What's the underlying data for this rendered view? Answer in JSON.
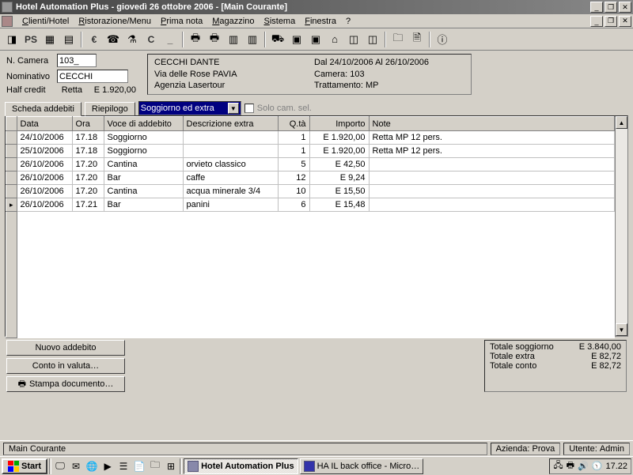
{
  "titlebar": {
    "title": "Hotel Automation Plus - giovedì 26 ottobre 2006 - [Main Courante]"
  },
  "menu": {
    "clienti": "Clienti/Hotel",
    "ristorazione": "Ristorazione/Menu",
    "prima_nota": "Prima nota",
    "magazzino": "Magazzino",
    "sistema": "Sistema",
    "finestra": "Finestra",
    "help": "?"
  },
  "form": {
    "n_camera_label": "N. Camera",
    "n_camera_value": "103_",
    "nominativo_label": "Nominativo",
    "nominativo_value": "CECCHI",
    "half_credit_label": "Half credit",
    "retta_label": "Retta",
    "retta_value": "E 1.920,00"
  },
  "panel": {
    "name": "CECCHI DANTE",
    "period": "Dal 24/10/2006 Al 26/10/2006",
    "address": "Via delle Rose PAVIA",
    "camera": "Camera: 103",
    "agenzia": "Agenzia Lasertour",
    "trattamento": "Trattamento: MP"
  },
  "tabs": {
    "scheda": "Scheda addebiti",
    "riepilogo": "Riepilogo",
    "combo_value": "Soggiorno ed extra",
    "solo_cam": "Solo cam. sel."
  },
  "grid": {
    "headers": {
      "data": "Data",
      "ora": "Ora",
      "voce": "Voce di addebito",
      "descr": "Descrizione extra",
      "qta": "Q.tà",
      "importo": "Importo",
      "note": "Note"
    },
    "rows": [
      {
        "data": "24/10/2006",
        "ora": "17.18",
        "voce": "Soggiorno",
        "descr": "",
        "qta": "1",
        "importo": "E 1.920,00",
        "note": "Retta MP 12 pers."
      },
      {
        "data": "25/10/2006",
        "ora": "17.18",
        "voce": "Soggiorno",
        "descr": "",
        "qta": "1",
        "importo": "E 1.920,00",
        "note": "Retta MP 12 pers."
      },
      {
        "data": "26/10/2006",
        "ora": "17.20",
        "voce": "Cantina",
        "descr": "orvieto classico",
        "qta": "5",
        "importo": "E 42,50",
        "note": ""
      },
      {
        "data": "26/10/2006",
        "ora": "17.20",
        "voce": "Bar",
        "descr": "caffe",
        "qta": "12",
        "importo": "E 9,24",
        "note": ""
      },
      {
        "data": "26/10/2006",
        "ora": "17.20",
        "voce": "Cantina",
        "descr": "acqua minerale 3/4",
        "qta": "10",
        "importo": "E 15,50",
        "note": ""
      },
      {
        "data": "26/10/2006",
        "ora": "17.21",
        "voce": "Bar",
        "descr": "panini",
        "qta": "6",
        "importo": "E 15,48",
        "note": ""
      }
    ]
  },
  "buttons": {
    "nuovo": "Nuovo addebito",
    "conto": "Conto in valuta…",
    "stampa": "Stampa documento…"
  },
  "totals": {
    "soggiorno_label": "Totale soggiorno",
    "soggiorno_value": "E 3.840,00",
    "extra_label": "Totale extra",
    "extra_value": "E 82,72",
    "conto_label": "Totale conto",
    "conto_value": "E 82,72"
  },
  "status": {
    "main": "Main Courante",
    "azienda_label": "Azienda:",
    "azienda_value": "Prova",
    "utente_label": "Utente:",
    "utente_value": "Admin"
  },
  "taskbar": {
    "start": "Start",
    "task1": "Hotel Automation Plus",
    "task2": "HA IL back office - Micro…",
    "clock": "17.22"
  }
}
